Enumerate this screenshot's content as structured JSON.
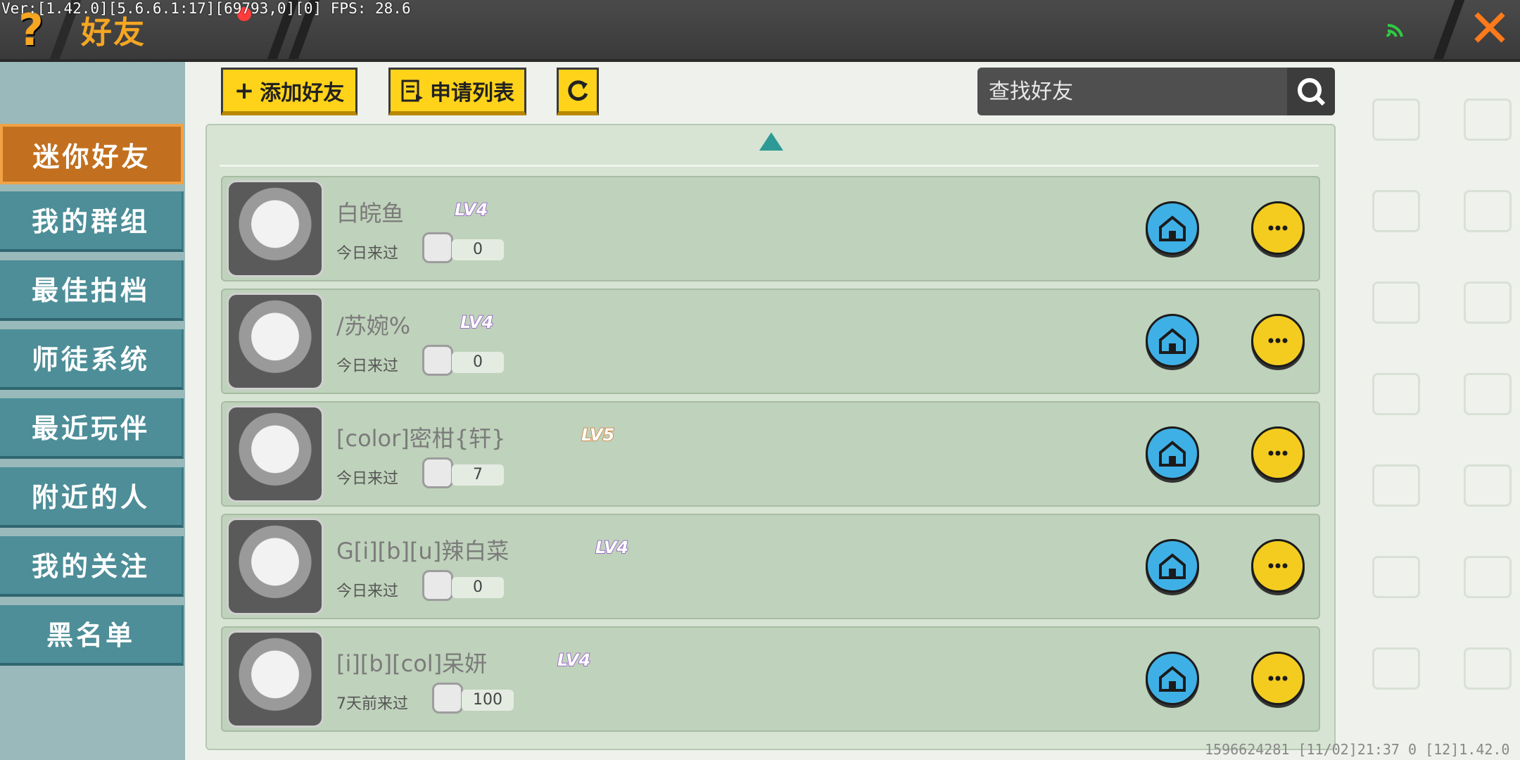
{
  "debug_overlay": "Ver:[1.42.0][5.6.6.1:17][69793,0][0] FPS: 28.6",
  "header": {
    "title": "好友",
    "help_icon": "question-mark-icon",
    "close_icon": "close-x-icon",
    "accent_color": "#f5a623",
    "close_color": "#ff7a1a"
  },
  "sidebar": {
    "items": [
      {
        "label": "迷你好友",
        "active": true
      },
      {
        "label": "我的群组",
        "active": false
      },
      {
        "label": "最佳拍档",
        "active": false
      },
      {
        "label": "师徒系统",
        "active": false
      },
      {
        "label": "最近玩伴",
        "active": false
      },
      {
        "label": "附近的人",
        "active": false
      },
      {
        "label": "我的关注",
        "active": false
      },
      {
        "label": "黑名单",
        "active": false
      }
    ],
    "active_color": "#c2701f",
    "item_color": "#4d8e98"
  },
  "toolbar": {
    "add_friend_label": "添加好友",
    "request_list_label": "申请列表",
    "refresh_icon": "refresh-icon",
    "search_placeholder": "查找好友"
  },
  "friends": [
    {
      "name": "白皖鱼",
      "level": "LV4",
      "last_visit": "今日来过",
      "count": "0"
    },
    {
      "name": "/苏婉%",
      "level": "LV4",
      "last_visit": "今日来过",
      "count": "0"
    },
    {
      "name": "[color]密柑{轩}",
      "level": "LV5",
      "last_visit": "今日来过",
      "count": "7"
    },
    {
      "name": "G[i][b][u]辣白菜",
      "level": "LV4",
      "last_visit": "今日来过",
      "count": "0"
    },
    {
      "name": "[i][b][col]呆妍",
      "level": "LV4",
      "last_visit": "7天前来过",
      "count": "100"
    }
  ],
  "footer": {
    "text": "1596624281   [11/02]21:37 0  [12]1.42.0"
  }
}
